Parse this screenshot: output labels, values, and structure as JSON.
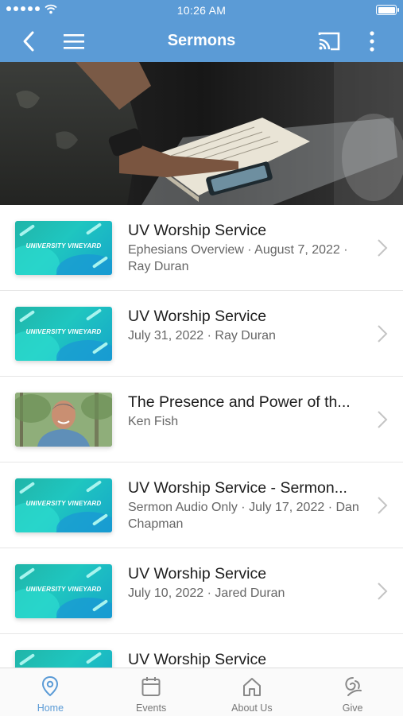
{
  "status": {
    "time": "10:26 AM"
  },
  "nav": {
    "title": "Sermons"
  },
  "thumb_brand": "UNIVERSITY VINEYARD",
  "sermons": [
    {
      "title": "UV Worship Service",
      "subtitle": "Ephesians Overview · August 7, 2022 · Ray Duran",
      "thumb": "uv"
    },
    {
      "title": "UV Worship Service",
      "subtitle": "July 31, 2022 · Ray Duran",
      "thumb": "uv"
    },
    {
      "title": "The Presence and Power of th...",
      "subtitle": "Ken Fish",
      "thumb": "photo"
    },
    {
      "title": "UV Worship Service - Sermon...",
      "subtitle": "Sermon Audio Only · July 17, 2022 · Dan Chapman",
      "thumb": "uv"
    },
    {
      "title": "UV Worship Service",
      "subtitle": "July 10, 2022 · Jared Duran",
      "thumb": "uv"
    },
    {
      "title": "UV Worship Service",
      "subtitle": "",
      "thumb": "uv"
    }
  ],
  "tabs": [
    {
      "label": "Home",
      "icon": "location-pin-icon",
      "active": true
    },
    {
      "label": "Events",
      "icon": "calendar-icon",
      "active": false
    },
    {
      "label": "About Us",
      "icon": "home-icon",
      "active": false
    },
    {
      "label": "Give",
      "icon": "give-icon",
      "active": false
    }
  ],
  "colors": {
    "accent": "#5b9bd6",
    "header": "#5b9bd6",
    "thumb_teal": "#1fc6c0"
  }
}
